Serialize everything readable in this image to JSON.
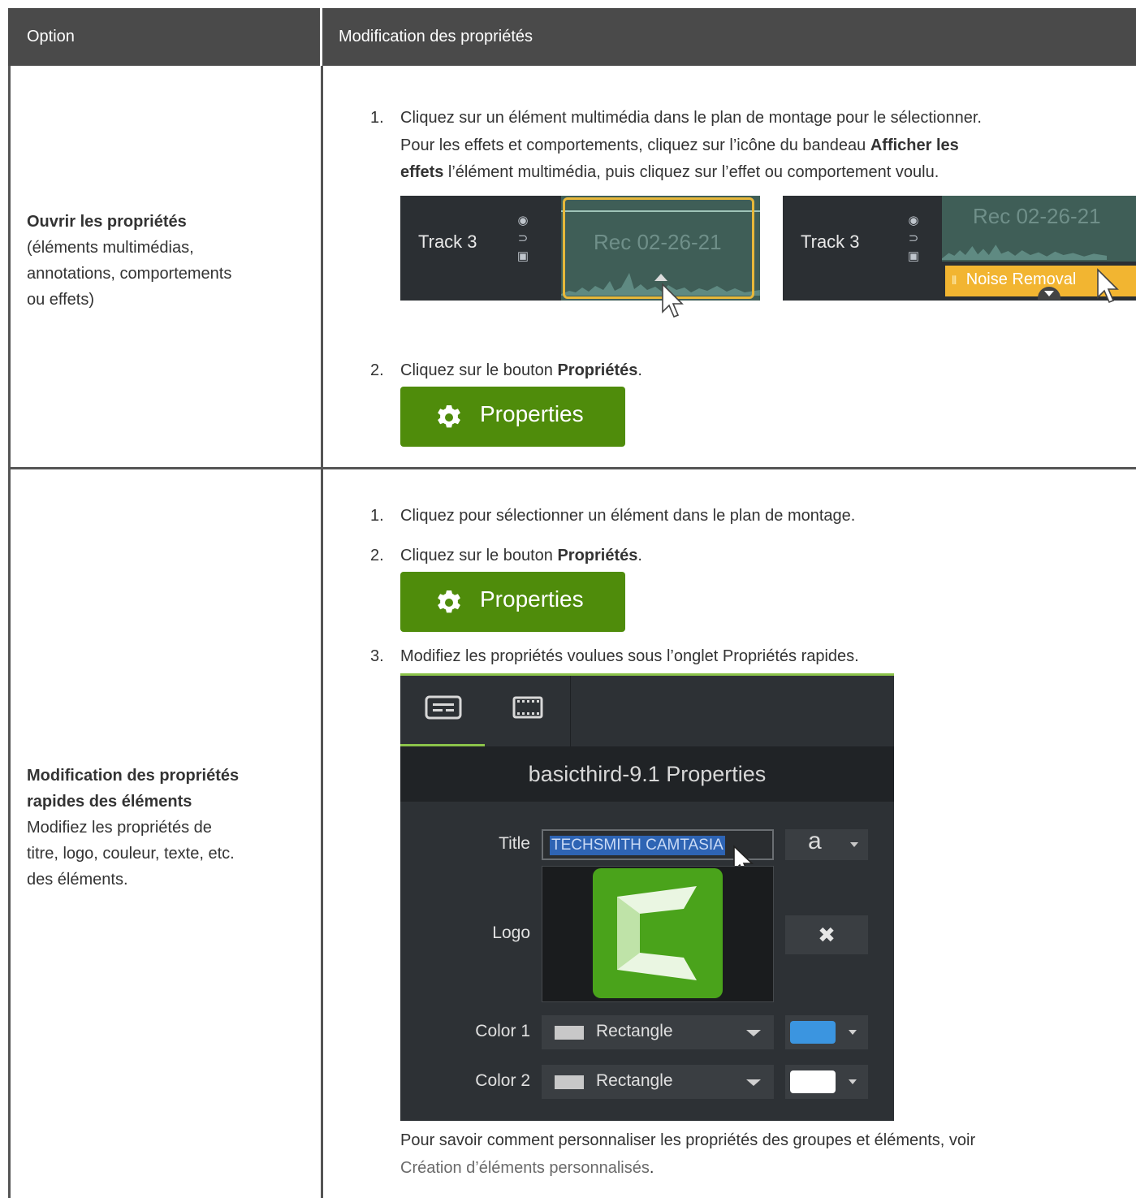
{
  "table": {
    "headers": [
      "Option",
      "Modification des propriétés"
    ],
    "row1": {
      "option_title": "Ouvrir les propriétés",
      "option_desc_lines": [
        "(éléments multimédias,",
        "annotations, comportements",
        "ou effets)"
      ],
      "step1_num": "1.",
      "step1_lines": [
        "Cliquez sur un élément multimédia dans le plan de montage pour le sélectionner.",
        "Pour les effets et comportements, cliquez sur l’icône du bandeau ",
        "Afficher les",
        "effets",
        " l’élément multimédia, puis cliquez sur l’effet ou comportement voulu."
      ],
      "step2_num": "2.",
      "step2_pre": "Cliquez sur le bouton ",
      "step2_bold": "Propriétés",
      "step2_post": "."
    },
    "row2": {
      "option_title_lines": [
        "Modification des propriétés",
        "rapides des éléments"
      ],
      "option_desc_lines": [
        "Modifiez les propriétés de",
        "titre, logo, couleur, texte, etc.",
        "des éléments."
      ],
      "step1_num": "1.",
      "step1_text": "Cliquez pour sélectionner un élément dans le plan de montage.",
      "step2_num": "2.",
      "step2_pre": "Cliquez sur le bouton ",
      "step2_bold": "Propriétés",
      "step2_post": ".",
      "step3_num": "3.",
      "step3_text": "Modifiez les propriétés voulues sous l’onglet Propriétés rapides.",
      "note_line1": "Pour savoir comment personnaliser les propriétés des groupes et éléments, voir",
      "note_link": "Création d’éléments personnalisés",
      "note_end": "."
    }
  },
  "tracks": {
    "track_label": "Track 3",
    "clip_label": "Rec 02-26-21",
    "effect_label": "Noise Removal"
  },
  "properties_button": {
    "label": "Properties",
    "color": "#4f8c0b"
  },
  "panel": {
    "title": "basicthird-9.1 Properties",
    "title_label": "Title",
    "title_value": "TECHSMITH CAMTASIA",
    "font_glyph": "a",
    "logo_label": "Logo",
    "remove_glyph": "✖",
    "color1_label": "Color 1",
    "color2_label": "Color 2",
    "color1_type": "Rectangle",
    "color2_type": "Rectangle",
    "color1_value": "#3b95e0",
    "color2_value": "#ffffff",
    "accent": "#8bc34a"
  }
}
